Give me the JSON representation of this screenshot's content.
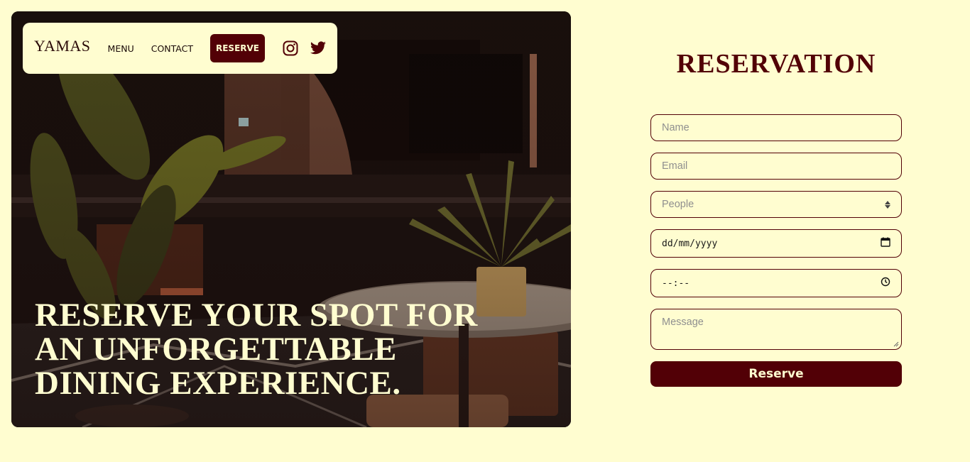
{
  "nav": {
    "brand": "YAMAS",
    "links": [
      "MENU",
      "CONTACT"
    ],
    "reserve_label": "RESERVE",
    "social_icons": [
      "instagram-icon",
      "twitter-icon"
    ]
  },
  "hero": {
    "headline": "RESERVE YOUR SPOT FOR AN UNFORGETTABLE DINING EXPERIENCE."
  },
  "form": {
    "title": "RESERVATION",
    "name_placeholder": "Name",
    "email_placeholder": "Email",
    "people_placeholder": "People",
    "date_placeholder": "dd/mm/yyyy",
    "time_placeholder": "--:--",
    "message_placeholder": "Message",
    "submit_label": "Reserve"
  },
  "colors": {
    "background": "#fffdd0",
    "accent": "#520006"
  }
}
